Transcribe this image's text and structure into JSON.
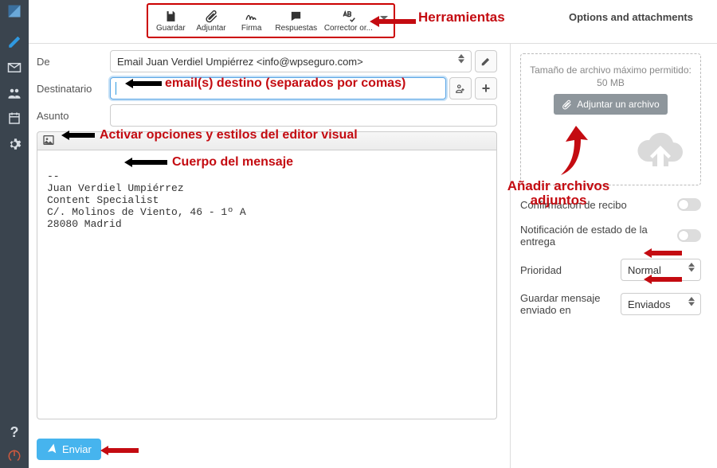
{
  "sidebar": {
    "items": [
      {
        "name": "compose",
        "active": true
      },
      {
        "name": "mail"
      },
      {
        "name": "contacts"
      },
      {
        "name": "calendar"
      },
      {
        "name": "settings"
      }
    ]
  },
  "toolbar": {
    "save": "Guardar",
    "attach": "Adjuntar",
    "signature": "Firma",
    "responses": "Respuestas",
    "spellcheck": "Corrector or..."
  },
  "header": {
    "options_attachments": "Options and attachments"
  },
  "form": {
    "from_label": "De",
    "from_value": "Email Juan Verdiel Umpiérrez <info@wpseguro.com>",
    "to_label": "Destinatario",
    "to_value": "",
    "subject_label": "Asunto",
    "subject_value": ""
  },
  "editor": {
    "body": "\n--\nJuan Verdiel Umpiérrez\nContent Specialist\nC/. Molinos de Viento, 46 - 1º A\n28080 Madrid"
  },
  "send": {
    "label": "Enviar"
  },
  "attachments": {
    "max": "Tamaño de archivo máximo permitido: 50 MB",
    "button": "Adjuntar un archivo"
  },
  "options": {
    "return_receipt": "Confirmación de recibo",
    "dsn": "Notificación de estado de la entrega",
    "priority_label": "Prioridad",
    "priority_value": "Normal",
    "save_in_label": "Guardar mensaje enviado en",
    "save_in_value": "Enviados"
  },
  "annotations": {
    "herramientas": "Herramientas",
    "dest": "email(s) destino (separados por comas)",
    "editor_toggle": "Activar opciones y estilos del editor visual",
    "body": "Cuerpo del mensaje",
    "attach": "Añadir archivos adjuntos"
  }
}
